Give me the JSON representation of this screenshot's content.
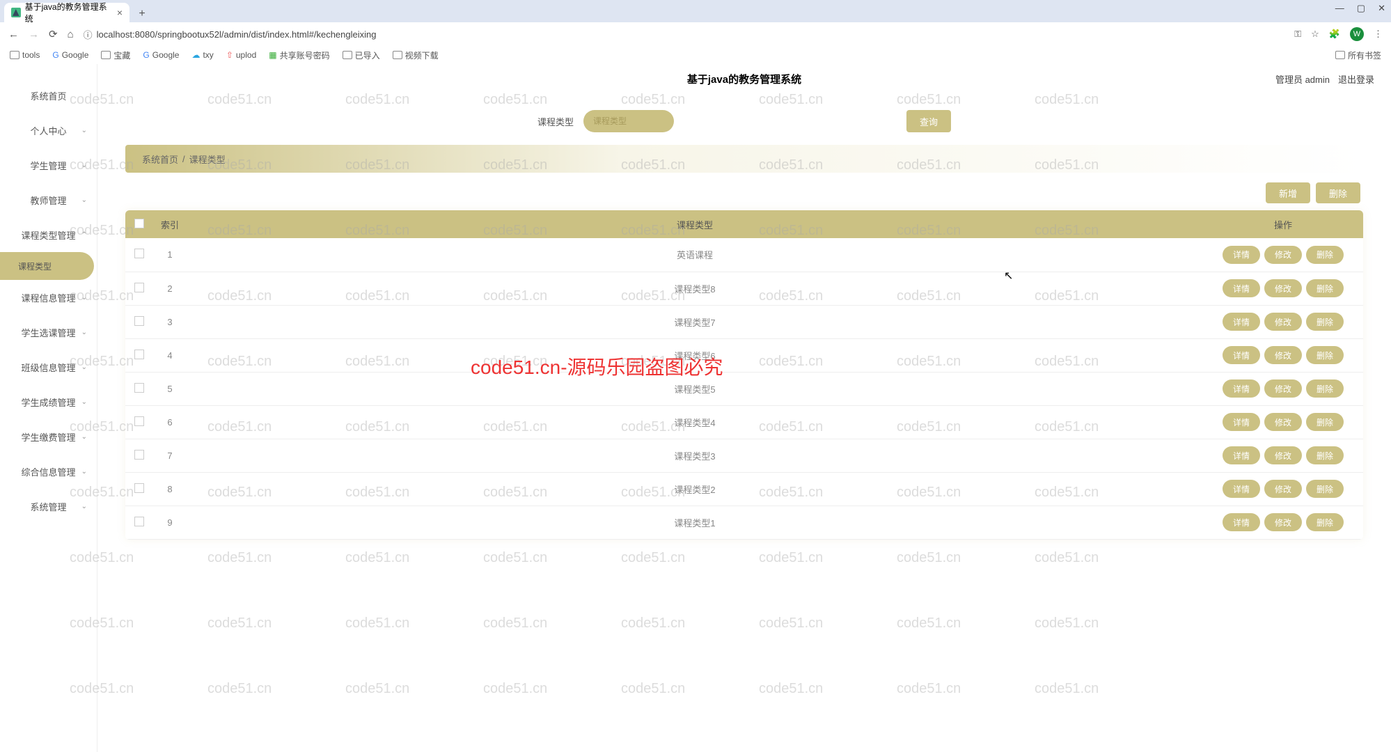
{
  "browser": {
    "tab_title": "基于java的教务管理系统",
    "url": "localhost:8080/springbootux52l/admin/dist/index.html#/kechengleixing",
    "avatar_letter": "W",
    "bookmarks": [
      "tools",
      "Google",
      "宝藏",
      "Google",
      "txy",
      "uplod",
      "共享账号密码",
      "已导入",
      "视频下载"
    ],
    "all_bookmarks": "所有书签"
  },
  "app": {
    "title": "基于java的教务管理系统",
    "user_role": "管理员 admin",
    "logout": "退出登录"
  },
  "sidebar": {
    "items": [
      {
        "label": "系统首页",
        "expandable": false
      },
      {
        "label": "个人中心",
        "expandable": true
      },
      {
        "label": "学生管理",
        "expandable": true
      },
      {
        "label": "教师管理",
        "expandable": true
      },
      {
        "label": "课程类型管理",
        "expandable": true,
        "expanded": true,
        "children": [
          {
            "label": "课程类型",
            "active": true
          }
        ]
      },
      {
        "label": "课程信息管理",
        "expandable": true
      },
      {
        "label": "学生选课管理",
        "expandable": true
      },
      {
        "label": "班级信息管理",
        "expandable": true
      },
      {
        "label": "学生成绩管理",
        "expandable": true
      },
      {
        "label": "学生缴费管理",
        "expandable": true
      },
      {
        "label": "综合信息管理",
        "expandable": true
      },
      {
        "label": "系统管理",
        "expandable": true
      }
    ]
  },
  "filter": {
    "label": "课程类型",
    "placeholder": "课程类型",
    "query_btn": "查询"
  },
  "breadcrumb": {
    "home": "系统首页",
    "sep": "/",
    "current": "课程类型"
  },
  "actions": {
    "add": "新增",
    "delete": "删除"
  },
  "table": {
    "headers": {
      "index": "索引",
      "type": "课程类型",
      "ops": "操作"
    },
    "row_btns": {
      "detail": "详情",
      "edit": "修改",
      "delete": "删除"
    },
    "rows": [
      {
        "idx": "1",
        "type": "英语课程"
      },
      {
        "idx": "2",
        "type": "课程类型8"
      },
      {
        "idx": "3",
        "type": "课程类型7"
      },
      {
        "idx": "4",
        "type": "课程类型6"
      },
      {
        "idx": "5",
        "type": "课程类型5"
      },
      {
        "idx": "6",
        "type": "课程类型4"
      },
      {
        "idx": "7",
        "type": "课程类型3"
      },
      {
        "idx": "8",
        "type": "课程类型2"
      },
      {
        "idx": "9",
        "type": "课程类型1"
      }
    ]
  },
  "watermark": "code51.cn",
  "red_text": "code51.cn-源码乐园盗图必究"
}
